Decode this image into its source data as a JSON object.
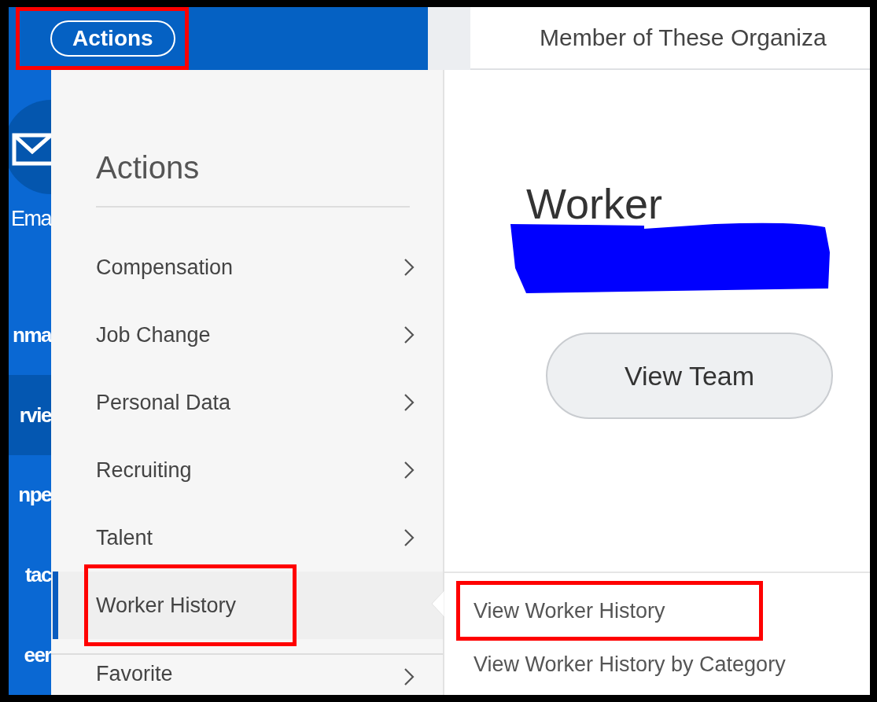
{
  "top_bar": {
    "actions_button": {
      "label": "Actions",
      "highlighted": true
    }
  },
  "tab": {
    "label": "Member of These Organiza"
  },
  "side_nav": [
    {
      "label": "Ema",
      "kind": "email",
      "selected": false
    },
    {
      "label": "nma",
      "kind": "text",
      "selected": false
    },
    {
      "label": "rvie",
      "kind": "text",
      "selected": true
    },
    {
      "label": "npe",
      "kind": "text",
      "selected": false
    },
    {
      "label": "tac",
      "kind": "text",
      "selected": false
    },
    {
      "label": "eer",
      "kind": "text",
      "selected": false
    }
  ],
  "actions_menu": {
    "title": "Actions",
    "items": [
      {
        "label": "Compensation",
        "has_submenu": true,
        "selected": false,
        "highlighted": false
      },
      {
        "label": "Job Change",
        "has_submenu": true,
        "selected": false,
        "highlighted": false
      },
      {
        "label": "Personal Data",
        "has_submenu": true,
        "selected": false,
        "highlighted": false
      },
      {
        "label": "Recruiting",
        "has_submenu": true,
        "selected": false,
        "highlighted": false
      },
      {
        "label": "Talent",
        "has_submenu": true,
        "selected": false,
        "highlighted": false
      },
      {
        "label": "Worker History",
        "has_submenu": false,
        "selected": true,
        "highlighted": true
      }
    ],
    "favorites": {
      "label": "Favorite",
      "has_submenu": true
    }
  },
  "submenu": {
    "items": [
      {
        "label": "View Worker History",
        "highlighted": true
      },
      {
        "label": "View Worker History by Category",
        "highlighted": false
      }
    ]
  },
  "profile": {
    "title": "Worker",
    "name_redacted": true,
    "button": "View Team"
  }
}
